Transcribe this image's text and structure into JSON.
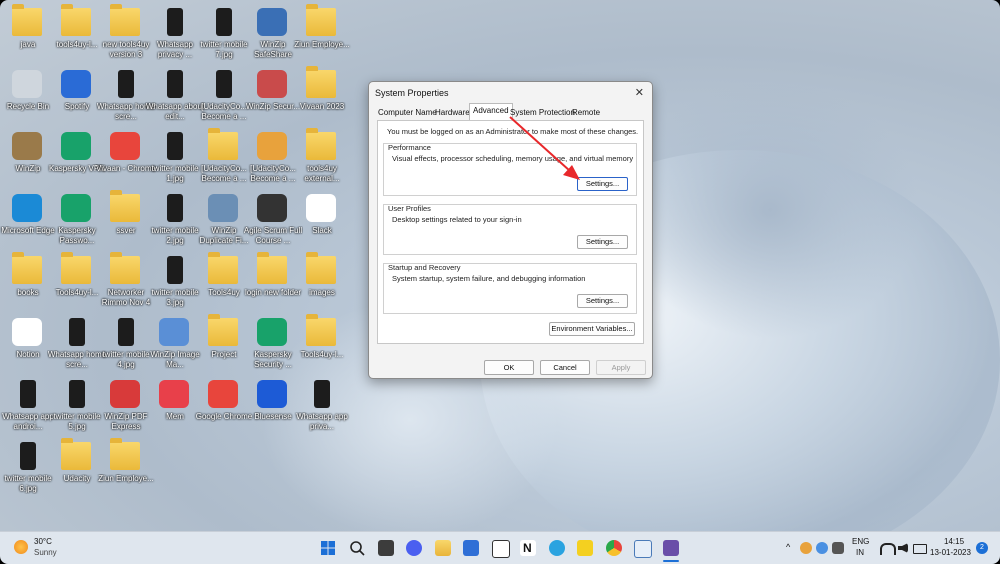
{
  "desktop": {
    "icons": [
      {
        "label": "java",
        "type": "folder"
      },
      {
        "label": "tools4uy-l...",
        "type": "folder"
      },
      {
        "label": "new tools4uy version 3",
        "type": "folder"
      },
      {
        "label": "Whatsapp privacy ...",
        "type": "phone"
      },
      {
        "label": "twitter mobile 7.jpg",
        "type": "phone"
      },
      {
        "label": "WinZip SafeShare",
        "type": "app",
        "color": "#3a6fb5"
      },
      {
        "label": "Ziun Employe...",
        "type": "folder"
      },
      {
        "label": "Recycle Bin",
        "type": "app",
        "color": "#cfd6dd"
      },
      {
        "label": "Spotify",
        "type": "app",
        "color": "#2a6bd6"
      },
      {
        "label": "Whatsapp home scre...",
        "type": "phone"
      },
      {
        "label": "Whatsapp about edit...",
        "type": "phone"
      },
      {
        "label": "[UdacityCo... Become a ...",
        "type": "phone"
      },
      {
        "label": "WinZip Secur...",
        "type": "app",
        "color": "#c94b4b"
      },
      {
        "label": "Vivaan 2023",
        "type": "folder"
      },
      {
        "label": "WinZip",
        "type": "app",
        "color": "#9a7a4a"
      },
      {
        "label": "Kaspersky VPN",
        "type": "app",
        "color": "#18a26a"
      },
      {
        "label": "Vivaan - Chrome",
        "type": "app",
        "color": "#e8453c"
      },
      {
        "label": "twitter mobile 1.jpg",
        "type": "phone"
      },
      {
        "label": "[UdacityCo... Become a ...",
        "type": "folder"
      },
      {
        "label": "[UdacityCo... Become a ...",
        "type": "app",
        "color": "#e8a23c"
      },
      {
        "label": "tools4uy external...",
        "type": "folder"
      },
      {
        "label": "Microsoft Edge",
        "type": "app",
        "color": "#1b8ad6"
      },
      {
        "label": "Kaspersky Passwo...",
        "type": "app",
        "color": "#18a26a"
      },
      {
        "label": "ssver",
        "type": "folder"
      },
      {
        "label": "twitter mobile 2.jpg",
        "type": "phone"
      },
      {
        "label": "WinZip Duplicate Fi...",
        "type": "app",
        "color": "#6b8fb5"
      },
      {
        "label": "Agile Scrum Full Course ...",
        "type": "app",
        "color": "#333333"
      },
      {
        "label": "Slack",
        "type": "app",
        "color": "#ffffff"
      },
      {
        "label": "books",
        "type": "folder"
      },
      {
        "label": "Tools4uy-l...",
        "type": "folder"
      },
      {
        "label": "Networker Rimmo Nov 4",
        "type": "folder"
      },
      {
        "label": "twitter mobile 3.jpg",
        "type": "phone"
      },
      {
        "label": "Tools4uy",
        "type": "folder"
      },
      {
        "label": "login new folder",
        "type": "folder"
      },
      {
        "label": "images",
        "type": "folder"
      },
      {
        "label": "Notion",
        "type": "app",
        "color": "#ffffff"
      },
      {
        "label": "Whatsapp home scre...",
        "type": "phone"
      },
      {
        "label": "twitter mobile 4.jpg",
        "type": "phone"
      },
      {
        "label": "WinZip Image Ma...",
        "type": "app",
        "color": "#5a8fd6"
      },
      {
        "label": "Project",
        "type": "folder"
      },
      {
        "label": "Kaspersky Security ...",
        "type": "app",
        "color": "#18a26a"
      },
      {
        "label": "Tools4uy-l...",
        "type": "folder"
      },
      {
        "label": "Whatsapp app androi...",
        "type": "phone"
      },
      {
        "label": "twitter mobile 5.jpg",
        "type": "phone"
      },
      {
        "label": "WinZip PDF Express",
        "type": "app",
        "color": "#d83a3a"
      },
      {
        "label": "Mem",
        "type": "app",
        "color": "#e8404a"
      },
      {
        "label": "Google Chrome",
        "type": "app",
        "color": "#e8453c"
      },
      {
        "label": "Bluesense",
        "type": "app",
        "color": "#1d5bd6"
      },
      {
        "label": "Whatsapp app priva...",
        "type": "phone"
      },
      {
        "label": "twitter mobile 6.jpg",
        "type": "phone"
      },
      {
        "label": "Udacity",
        "type": "folder"
      },
      {
        "label": "Ziun Employe...",
        "type": "folder"
      }
    ]
  },
  "dialog": {
    "title": "System Properties",
    "close_glyph": "✕",
    "tabs": [
      "Computer Name",
      "Hardware",
      "Advanced",
      "System Protection",
      "Remote"
    ],
    "active_tab": "Advanced",
    "admin_note": "You must be logged on as an Administrator to make most of these changes.",
    "performance": {
      "title": "Performance",
      "desc": "Visual effects, processor scheduling, memory usage, and virtual memory",
      "button": "Settings..."
    },
    "user_profiles": {
      "title": "User Profiles",
      "desc": "Desktop settings related to your sign-in",
      "button": "Settings..."
    },
    "startup": {
      "title": "Startup and Recovery",
      "desc": "System startup, system failure, and debugging information",
      "button": "Settings..."
    },
    "env_button": "Environment Variables...",
    "ok": "OK",
    "cancel": "Cancel",
    "apply": "Apply"
  },
  "annotation": {
    "arrow_color": "#e8282b"
  },
  "taskbar": {
    "weather_temp": "30°C",
    "weather_desc": "Sunny",
    "apps": [
      "start",
      "search",
      "task-view",
      "zoom",
      "file-explorer",
      "store",
      "notion",
      "telegram",
      "sticky-notes",
      "chrome",
      "snipping",
      "winzip"
    ],
    "tray_caret": "^",
    "lang": "ENG",
    "region": "IN",
    "time": "14:15",
    "date": "13-01-2023",
    "notification_count": "2"
  }
}
